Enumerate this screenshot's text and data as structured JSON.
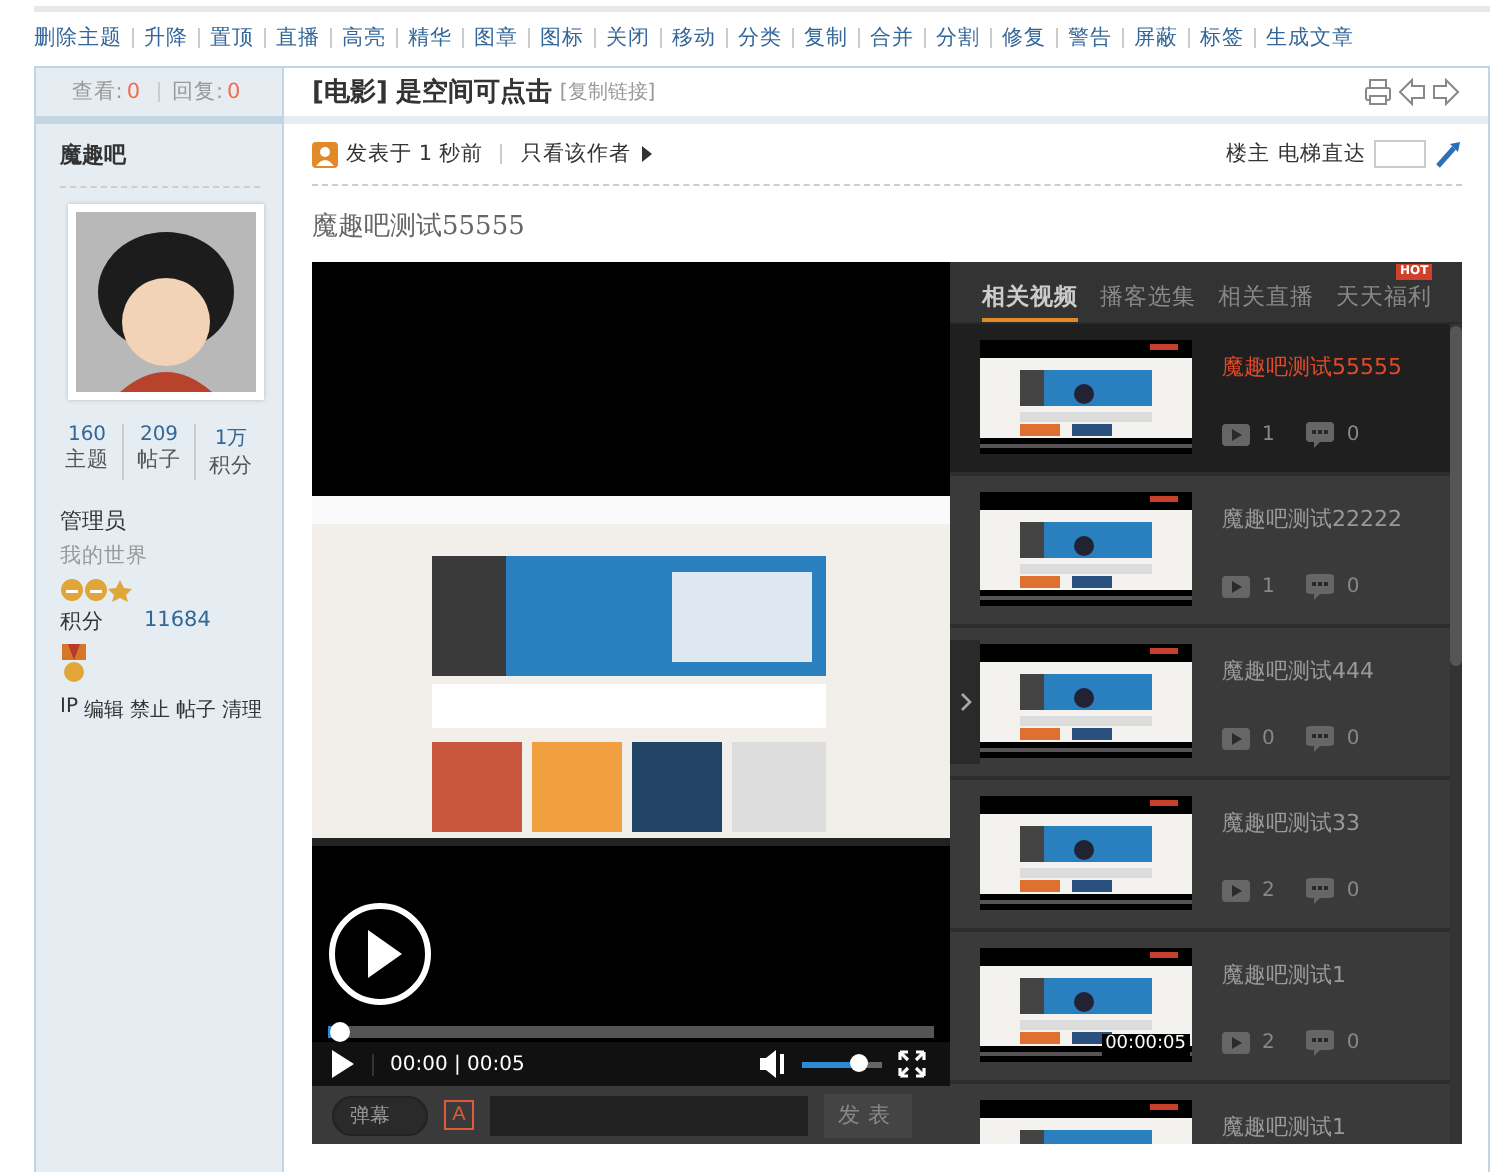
{
  "mod_actions": [
    "删除主题",
    "升降",
    "置顶",
    "直播",
    "高亮",
    "精华",
    "图章",
    "图标",
    "关闭",
    "移动",
    "分类",
    "复制",
    "合并",
    "分割",
    "修复",
    "警告",
    "屏蔽",
    "标签",
    "生成文章"
  ],
  "thread": {
    "views_label": "查看:",
    "views": "0",
    "replies_label": "回复:",
    "replies": "0",
    "category": "[电影]",
    "title": "是空间可点击",
    "copy_link": "[复制链接]"
  },
  "author": {
    "name": "魔趣吧",
    "stats": [
      {
        "value": "160",
        "label": "主题"
      },
      {
        "value": "209",
        "label": "帖子"
      },
      {
        "value": "1万",
        "label": "积分"
      }
    ],
    "group": "管理员",
    "title": "我的世界",
    "points_label": "积分",
    "points": "11684",
    "actions": [
      "IP",
      "编辑",
      "禁止",
      "帖子",
      "清理"
    ]
  },
  "post": {
    "posted": "发表于 1 秒前",
    "only_author": "只看该作者",
    "floor": "楼主",
    "elevator": "电梯直达",
    "text": "魔趣吧测试55555"
  },
  "player": {
    "time": "00:00 | 00:05",
    "progress": {
      "level": 0.02
    },
    "volume": {
      "level": 0.7
    },
    "danmu": {
      "label": "弹幕",
      "on": false
    },
    "danmu_style": "A",
    "send": "发表"
  },
  "related": {
    "tabs": [
      {
        "label": "相关视频",
        "selected": true
      },
      {
        "label": "播客选集",
        "selected": false
      },
      {
        "label": "相关直播",
        "selected": false
      },
      {
        "label": "天天福利",
        "selected": false,
        "badge": "HOT"
      }
    ],
    "items": [
      {
        "title": "魔趣吧测试55555",
        "plays": "1",
        "comments": "0",
        "selected": true
      },
      {
        "title": "魔趣吧测试22222",
        "plays": "1",
        "comments": "0",
        "selected": false
      },
      {
        "title": "魔趣吧测试444",
        "plays": "0",
        "comments": "0",
        "selected": false
      },
      {
        "title": "魔趣吧测试33",
        "plays": "2",
        "comments": "0",
        "selected": false
      },
      {
        "title": "魔趣吧测试1",
        "plays": "2",
        "comments": "0",
        "selected": false,
        "duration": "00:00:05"
      },
      {
        "title": "魔趣吧测试1",
        "selected": false
      }
    ]
  }
}
